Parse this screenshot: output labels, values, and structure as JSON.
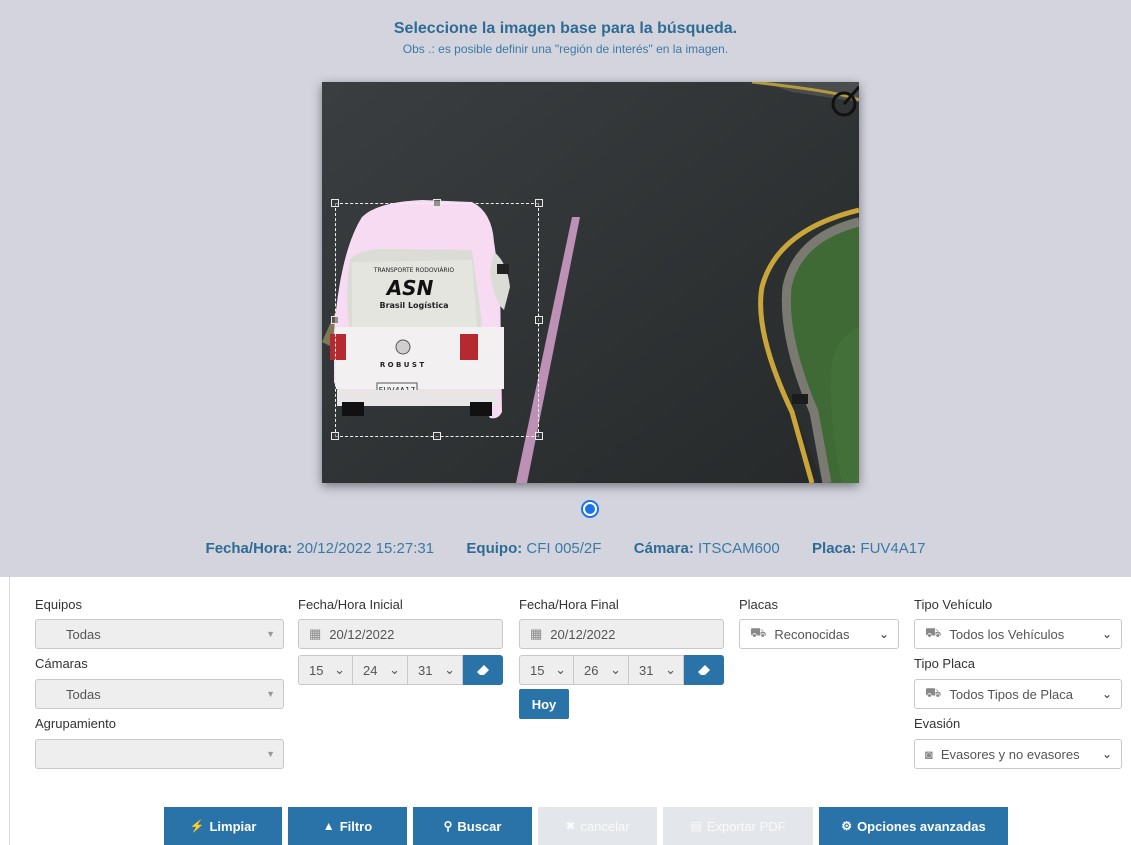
{
  "header": {
    "title": "Seleccione la imagen base para la búsqueda.",
    "subtitle": "Obs .: es posible definir una \"región de interés\" en la imagen."
  },
  "image": {
    "plate_text": "FUV4A17",
    "van_brand": "ASN",
    "van_text": "Brasil Logística",
    "van_model": "R O B U S T"
  },
  "info": {
    "fecha_label": "Fecha/Hora:",
    "fecha_value": "20/12/2022 15:27:31",
    "equipo_label": "Equipo:",
    "equipo_value": "CFI 005/2F",
    "camara_label": "Cámara:",
    "camara_value": "ITSCAM600",
    "placa_label": "Placa:",
    "placa_value": "FUV4A17"
  },
  "filters": {
    "equipos_label": "Equipos",
    "equipos_value": "Todas",
    "camaras_label": "Cámaras",
    "camaras_value": "Todas",
    "agrupamiento_label": "Agrupamiento",
    "agrupamiento_value": "",
    "fecha_inicial_label": "Fecha/Hora Inicial",
    "fecha_inicial_value": "20/12/2022",
    "inicial_hour": "15",
    "inicial_minute": "24",
    "inicial_second": "31",
    "fecha_final_label": "Fecha/Hora Final",
    "fecha_final_value": "20/12/2022",
    "final_hour": "15",
    "final_minute": "26",
    "final_second": "31",
    "hoy_label": "Hoy",
    "placas_label": "Placas",
    "placas_value": "Reconocidas",
    "tipo_vehiculo_label": "Tipo Vehículo",
    "tipo_vehiculo_value": "Todos los Vehículos",
    "tipo_placa_label": "Tipo Placa",
    "tipo_placa_value": "Todos Tipos de Placa",
    "evasion_label": "Evasión",
    "evasion_value": "Evasores y no evasores"
  },
  "buttons": {
    "limpiar": "Limpiar",
    "filtro": "Filtro",
    "buscar": "Buscar",
    "cancelar": "cancelar",
    "exportar": "Exportar PDF",
    "opciones": "Opciones avanzadas"
  },
  "colors": {
    "accent": "#2a73a8",
    "panel": "#d3d4de",
    "title": "#2f6c93"
  },
  "icons": {
    "calendar": "calendar-icon",
    "eraser": "eraser-icon",
    "car": "car-icon",
    "camera": "camera-icon",
    "magic": "magic-wand-icon",
    "chevron_up": "chevron-up-icon",
    "search": "search-icon",
    "times": "times-icon",
    "file_pdf": "file-pdf-icon",
    "cogs": "cogs-icon"
  }
}
